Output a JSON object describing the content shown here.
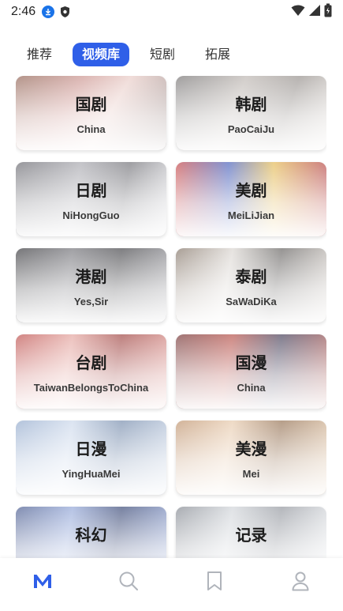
{
  "status_bar": {
    "time": "2:46",
    "icons": [
      "download-icon",
      "shield-icon",
      "wifi-icon",
      "signal-icon",
      "battery-icon"
    ]
  },
  "tabs": [
    {
      "label": "推荐",
      "active": false
    },
    {
      "label": "视频库",
      "active": true
    },
    {
      "label": "短剧",
      "active": false
    },
    {
      "label": "拓展",
      "active": false
    }
  ],
  "cards": [
    {
      "title": "国剧",
      "subtitle": "China"
    },
    {
      "title": "韩剧",
      "subtitle": "PaoCaiJu"
    },
    {
      "title": "日剧",
      "subtitle": "NiHongGuo"
    },
    {
      "title": "美剧",
      "subtitle": "MeiLiJian"
    },
    {
      "title": "港剧",
      "subtitle": "Yes,Sir"
    },
    {
      "title": "泰剧",
      "subtitle": "SaWaDiKa"
    },
    {
      "title": "台剧",
      "subtitle": "TaiwanBelongsToChina"
    },
    {
      "title": "国漫",
      "subtitle": "China"
    },
    {
      "title": "日漫",
      "subtitle": "YingHuaMei"
    },
    {
      "title": "美漫",
      "subtitle": "Mei"
    },
    {
      "title": "科幻",
      "subtitle": ""
    },
    {
      "title": "记录",
      "subtitle": ""
    }
  ],
  "bottom_nav": [
    {
      "icon": "home-m-icon",
      "active": true
    },
    {
      "icon": "search-icon",
      "active": false
    },
    {
      "icon": "bookmark-icon",
      "active": false
    },
    {
      "icon": "profile-icon",
      "active": false
    }
  ],
  "colors": {
    "accent": "#2f5fe8",
    "inactive_icon": "#b0b4bb"
  }
}
